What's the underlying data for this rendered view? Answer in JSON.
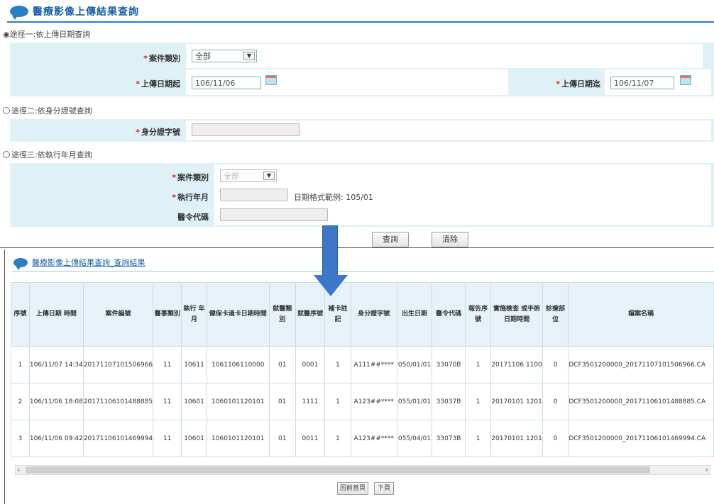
{
  "query_panel": {
    "title": "醫療影像上傳結果查詢",
    "option1": {
      "label": "◉途徑一:依上傳日期查詢",
      "case_type_label": "案件類別",
      "case_type_value": "全部",
      "upload_start_label": "上傳日期起",
      "upload_start_value": "106/11/06",
      "upload_end_label": "上傳日期迄",
      "upload_end_value": "106/11/07"
    },
    "option2": {
      "label": "途徑二:依身分證號查詢",
      "id_label": "身分證字號",
      "id_value": ""
    },
    "option3": {
      "label": "途徑三:依執行年月查詢",
      "case_type_label": "案件類別",
      "case_type_value": "全部",
      "exec_month_label": "執行年月",
      "exec_month_value": "",
      "date_hint": "日期格式範例: 105/01",
      "hosp_code_label": "醫令代碼",
      "hosp_code_value": ""
    },
    "query_button": "查詢",
    "clear_button": "清除"
  },
  "result_panel": {
    "title": "醫療影像上傳結果查詢_查詢結果",
    "columns": [
      "序號",
      "上傳日期 時間",
      "案件編號",
      "醫事類別",
      "執行 年月",
      "健保卡過卡日期時間",
      "就醫類別",
      "就醫序號",
      "補卡註記",
      "身分證字號",
      "出生日期",
      "醫令代碼",
      "報告序號",
      "實施檢查 或手術日期時間",
      "診療部位",
      "檔案名稱"
    ],
    "rows": [
      [
        "1",
        "106/11/07 14:34",
        "20171107101506966",
        "11",
        "10611",
        "1061106110000",
        "01",
        "0001",
        "1",
        "A111##****",
        "050/01/01",
        "33070B",
        "1",
        "20171106 1100",
        "0",
        "DCF3501200000_20171107101506966.CA"
      ],
      [
        "2",
        "106/11/06 18:08",
        "20171106101488885",
        "11",
        "10601",
        "1060101120101",
        "01",
        "1111",
        "1",
        "A123##****",
        "055/01/01",
        "33037B",
        "1",
        "20170101 1201",
        "0",
        "DCF3501200000_20171106101488885.CA"
      ],
      [
        "3",
        "106/11/06 09:42",
        "20171106101469994",
        "11",
        "10601",
        "1060101120101",
        "01",
        "0011",
        "1",
        "A123##****",
        "055/04/01",
        "33073B",
        "1",
        "20170101 1201",
        "0",
        "DCF3501200000_20171106101469994.CA"
      ]
    ],
    "scroll_left": "‹",
    "scroll_right": "›",
    "first_page_button": "回前首頁",
    "next_page_button": "下頁"
  }
}
